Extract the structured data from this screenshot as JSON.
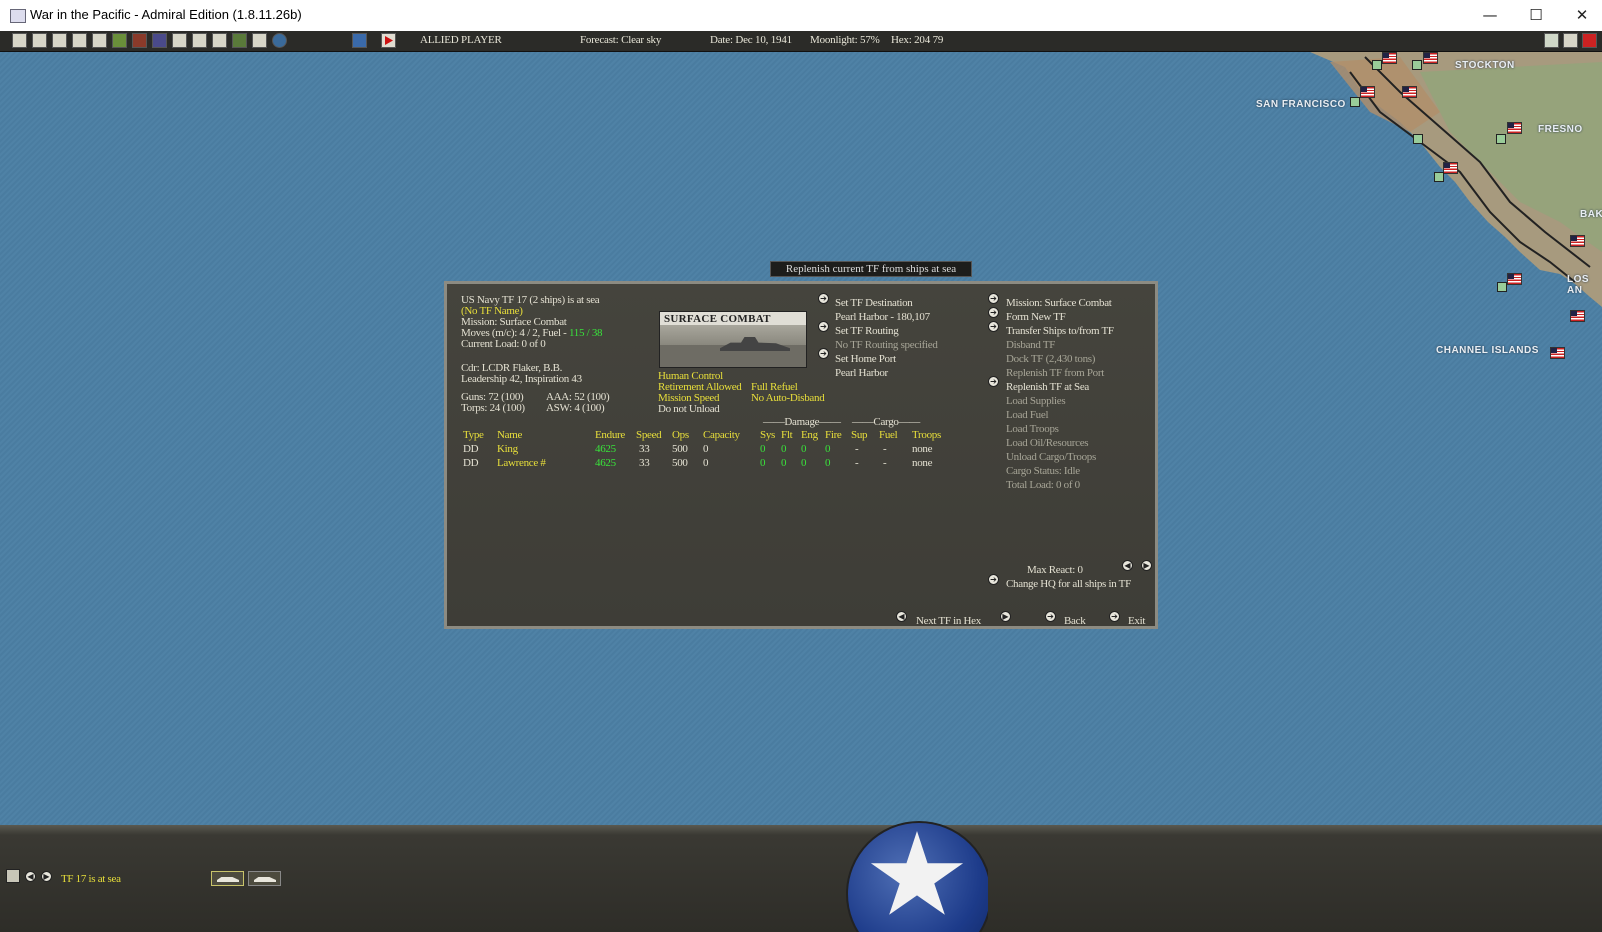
{
  "window": {
    "title": "War in the Pacific - Admiral Edition (1.8.11.26b)",
    "minimize": "—",
    "maximize": "☐",
    "close": "✕"
  },
  "toolbar": {
    "player": "ALLIED PLAYER",
    "forecast": "Forecast: Clear sky",
    "date": "Date: Dec 10, 1941",
    "moonlight": "Moonlight: 57%",
    "hex": "Hex: 204 79",
    "icons": [
      "report-icon",
      "list-icon",
      "ship-icon",
      "air-icon",
      "info-icon",
      "victory-icon",
      "base-icon",
      "unit-icon",
      "flag-icon",
      "port-icon",
      "air-hq-icon",
      "sub-icon",
      "land-icon",
      "globe-icon"
    ],
    "right_icons": [
      "map-icon",
      "play-icon"
    ],
    "corner_icons": [
      "restart-icon",
      "c-icon",
      "exit-icon"
    ]
  },
  "map": {
    "labels": [
      "STOCKTON",
      "SAN FRANCISCO",
      "FRESNO",
      "BAK",
      "LOS AN",
      "CHANNEL ISLANDS"
    ]
  },
  "hint": "Replenish current TF from ships at sea",
  "tf": {
    "header": "US Navy TF 17 (2 ships) is at sea",
    "name": "(No TF Name)",
    "mission": "Mission: Surface Combat",
    "moves_prefix": "Moves (m/c): 4 / 2, Fuel - ",
    "fuel": "115 / 38",
    "load": "Current Load: 0 of 0",
    "cdr": "Cdr: LCDR Flaker, B.B.",
    "leadership": "Leadership 42, Inspiration 43",
    "guns": "Guns: 72 (100)",
    "aaa": "AAA: 52 (100)",
    "torps": "Torps: 24 (100)",
    "asw": "ASW: 4 (100)",
    "image_title": "SURFACE COMBAT",
    "human_control": "Human Control",
    "retirement": "Retirement Allowed",
    "mission_speed": "Mission Speed",
    "do_not_unload": "Do not Unload",
    "full_refuel": "Full Refuel",
    "no_auto_disband": "No Auto-Disband"
  },
  "middle_menu": {
    "set_destination": "Set TF Destination",
    "destination": "Pearl Harbor - 180,107",
    "set_routing": "Set TF Routing",
    "routing": "No TF Routing specified",
    "set_home": "Set Home Port",
    "home": "Pearl Harbor"
  },
  "right_menu": {
    "mission": "Mission: Surface Combat",
    "form_new": "Form New TF",
    "transfer": "Transfer Ships to/from TF",
    "disband": "Disband TF",
    "dock": "Dock TF (2,430 tons)",
    "replenish_port": "Replenish TF from Port",
    "replenish_sea": "Replenish TF at Sea",
    "load_supplies": "Load Supplies",
    "load_fuel": "Load Fuel",
    "load_troops": "Load Troops",
    "load_oil": "Load Oil/Resources",
    "unload": "Unload Cargo/Troops",
    "cargo_status": "Cargo Status: Idle",
    "total_load": "Total Load: 0 of 0",
    "max_react": "Max React: 0",
    "change_hq": "Change HQ for all ships in TF"
  },
  "nav": {
    "next_tf": "Next TF in Hex",
    "back": "Back",
    "exit": "Exit"
  },
  "table": {
    "group_damage": "Damage",
    "group_cargo": "Cargo",
    "headers": [
      "Type",
      "Name",
      "Endure",
      "Speed",
      "Ops",
      "Capacity",
      "Sys",
      "Flt",
      "Eng",
      "Fire",
      "Sup",
      "Fuel",
      "Troops"
    ],
    "rows": [
      {
        "type": "DD",
        "name": "King",
        "endure": "4625",
        "speed": "33",
        "ops": "500",
        "capacity": "0",
        "sys": "0",
        "flt": "0",
        "eng": "0",
        "fire": "0",
        "sup": "-",
        "fuel": "-",
        "troops": "none"
      },
      {
        "type": "DD",
        "name": "Lawrence #",
        "endure": "4625",
        "speed": "33",
        "ops": "500",
        "capacity": "0",
        "sys": "0",
        "flt": "0",
        "eng": "0",
        "fire": "0",
        "sup": "-",
        "fuel": "-",
        "troops": "none"
      }
    ]
  },
  "bottom": {
    "status": "TF 17 is at sea"
  },
  "colors": {
    "sea": "#4f82a6",
    "panel": "#42413a",
    "yellow": "#e8df3a",
    "green": "#39e23b"
  }
}
